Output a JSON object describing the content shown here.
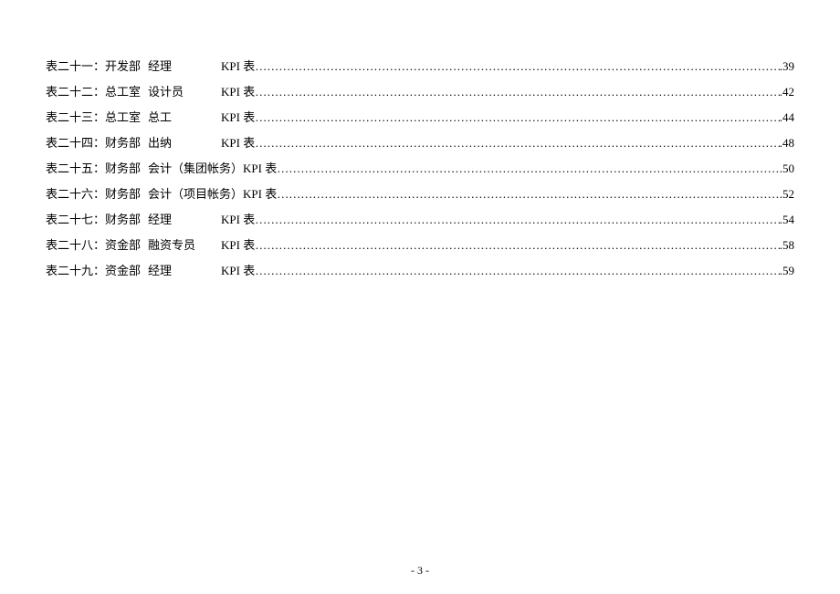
{
  "toc": {
    "kpi_label": "KPI 表",
    "entries": [
      {
        "prefix": "表二十一：",
        "dept": "开发部",
        "role": "经理",
        "page": "39"
      },
      {
        "prefix": "表二十二：",
        "dept": "总工室",
        "role": "设计员",
        "page": "42"
      },
      {
        "prefix": "表二十三：",
        "dept": "总工室",
        "role": "总工",
        "page": "44"
      },
      {
        "prefix": "表二十四：",
        "dept": "财务部",
        "role": "出纳",
        "page": "48"
      },
      {
        "prefix": "表二十五：",
        "dept": "财务部",
        "role": "会计（集团帐务）",
        "page": "50"
      },
      {
        "prefix": "表二十六：",
        "dept": "财务部",
        "role": "会计（项目帐务）",
        "page": "52"
      },
      {
        "prefix": "表二十七：",
        "dept": "财务部",
        "role": "经理",
        "page": "54"
      },
      {
        "prefix": "表二十八：",
        "dept": "资金部",
        "role": "融资专员",
        "page": "58"
      },
      {
        "prefix": "表二十九：",
        "dept": "资金部",
        "role": "经理",
        "page": "59"
      }
    ]
  },
  "page_number": "- 3 -"
}
